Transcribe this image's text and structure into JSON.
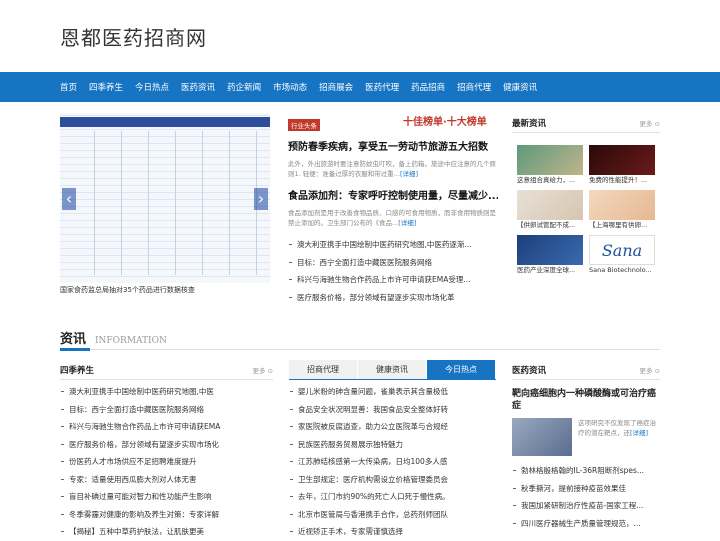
{
  "site": {
    "name": "恩都医药招商网"
  },
  "nav": [
    "首页",
    "四季养生",
    "今日热点",
    "医药资讯",
    "药企新闻",
    "市场动态",
    "招商展会",
    "医药代理",
    "药品招商",
    "招商代理",
    "健康资讯"
  ],
  "slider": {
    "caption": "国家食药监总局抽对35个药品进行数据核查",
    "prev": "‹",
    "next": "›"
  },
  "headline": {
    "badge": "行业头条",
    "banner": "十佳榜单·十大榜单",
    "title": "预防春季疾病，享受五一劳动节旅游五大招数",
    "desc": "此外，外出旅游时要注意防蚊虫叮咬，备上药箱。旅途中应注意的几个原则1. 轻便：准备过厚的衣服和带过重...",
    "desc_more": "[详细]",
    "title2": "食品添加剂：专家呼吁控制使用量，尽量减少...",
    "desc2": "食品添加剂是用于改善食物品质、口感的可食用物质，而非食用物质则是禁止添加的。卫生部门公布的《食品...",
    "desc2_more": "[详细]"
  },
  "top_list": [
    "澳大利亚携手中国绘制中医药研究地图,中医药逐渐...",
    "目标：西宁全面打造中藏医医院服务网络",
    "科兴与海驰生物合作药品上市许可申请获EMA受理...",
    "医疗服务价格，部分领域有望逐步实现市场化革"
  ],
  "latest": {
    "title": "最新资讯",
    "more": "更多",
    "items": [
      {
        "caption": "这意组合真给力，..."
      },
      {
        "caption": "免费的性能提升！..."
      },
      {
        "caption": "【供卵试管配不成..."
      },
      {
        "caption": "【上海哪里有供卵..."
      },
      {
        "caption": "医药产业深度全球..."
      },
      {
        "caption": "Sana Biotechnolo..."
      }
    ],
    "logo_text": "Sana"
  },
  "section": {
    "title": "资讯",
    "en": "INFORMATION"
  },
  "left_col": {
    "title": "四季养生",
    "more": "更多",
    "items": [
      "澳大利亚携手中国绘制中医药研究地图,中医",
      "目标：西宁全面打造中藏医医院服务网络",
      "科兴与海驰生物合作药品上市许可申请获EMA",
      "医疗服务价格，部分领域有望逐步实现市场化",
      "份医药人才市场供应不足招聘难度提升",
      "专家：适量使用西瓜膨大剂对人体无害",
      "盲目补碘过量可能对智力和性功能产生影响",
      "冬季雾霾对健康的影响及养生对策：专家详解",
      "【揭秘】五种中草药护肤法，让肌肤更美"
    ]
  },
  "mid_col": {
    "tabs": [
      "招商代理",
      "健康资讯",
      "今日热点"
    ],
    "active_tab": 2,
    "items": [
      "婴儿米粉的砷含量问题，雀巢表示其含量极低",
      "食品安全状况明显善：我国食品安全整体好转",
      "家医院被反腐逍查，助力公立医院革与合规经",
      "民族医药服务贸易展示独特魅力",
      "江苏肺结核感第一大传染病，日均100多人感",
      "卫生部规定：医疗机构需设立价格管理委员会",
      "去年，江门市约90%的死亡人口死于慢性病。",
      "北京市医管局与香港携手合作，总药剂师团队",
      "近视矫正手术，专家需谨慎选择"
    ]
  },
  "right_col": {
    "title": "医药资讯",
    "more": "更多",
    "feature_title": "靶向癌细胞内一种磷酸酶或可治疗癌症",
    "feature_desc": "这项研究不仅发现了癌症治疗的潜在靶点，还",
    "feature_more": "[详细]",
    "items": [
      "勃林格殷格翰的IL-36R阻断剂spes...",
      "秋季撕河，提前接种疫苗效果佳",
      "我国加紧研制治疗性疫苗-国家工程...",
      "四川医疗器械生产质量管理规范，..."
    ]
  },
  "colors": {
    "accent": "#1774c3",
    "badge": "#c0392b"
  }
}
